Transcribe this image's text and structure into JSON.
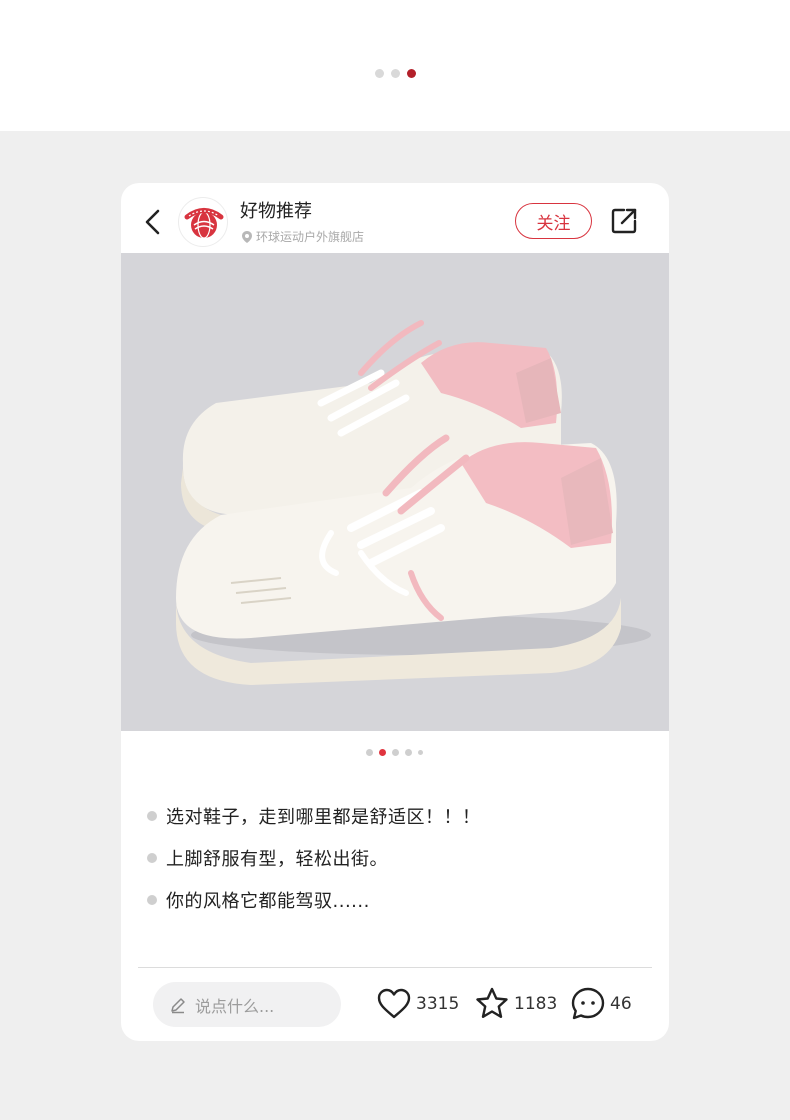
{
  "pager": {
    "count": 3,
    "active_index": 2
  },
  "post": {
    "title": "好物推荐",
    "location": "环球运动户外旗舰店",
    "follow_label": "关注",
    "avatar_icon": "huanqiu-brand-logo",
    "accent_color": "#d8343f"
  },
  "photo": {
    "subject_icon": "pink-white-platform-sneakers-photo"
  },
  "carousel": {
    "count": 5,
    "active_index": 1
  },
  "bullets": [
    "选对鞋子，走到哪里都是舒适区！！！",
    "上脚舒服有型，轻松出街。",
    "你的风格它都能驾驭......"
  ],
  "footer": {
    "comment_placeholder": "说点什么...",
    "likes": "3315",
    "favorites": "1183",
    "comments": "46"
  }
}
